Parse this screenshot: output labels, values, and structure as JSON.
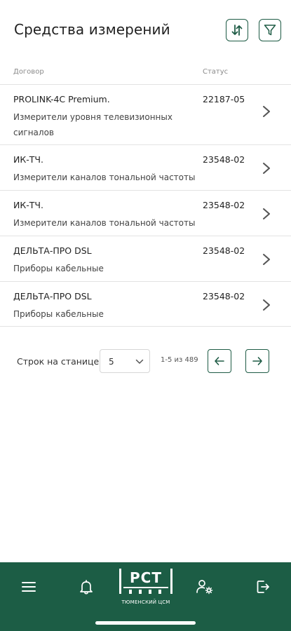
{
  "header": {
    "title": "Средства измерений",
    "sort_icon": "sort-arrows-icon",
    "filter_icon": "filter-icon"
  },
  "table": {
    "columns": {
      "contract": "Договор",
      "status": "Статус"
    },
    "rows": [
      {
        "name": "PROLINK-4C Premium.",
        "description": "Измерители уровня телевизионных сигналов",
        "status": "22187-05"
      },
      {
        "name": "ИК-ТЧ.",
        "description": "Измерители каналов тональной частоты",
        "status": "23548-02"
      },
      {
        "name": "ИК-ТЧ.",
        "description": "Измерители каналов тональной частоты",
        "status": "23548-02"
      },
      {
        "name": "ДЕЛЬТА-ПРО DSL",
        "description": "Приборы кабельные",
        "status": "23548-02"
      },
      {
        "name": "ДЕЛЬТА-ПРО DSL",
        "description": "Приборы кабельные",
        "status": "23548-02"
      }
    ]
  },
  "pagination": {
    "rows_per_page_label": "Строк на станице",
    "rows_per_page_value": "5",
    "range": "1-5 из 489"
  },
  "bottom_nav": {
    "items": [
      "menu-icon",
      "bell-icon",
      "logo",
      "user-settings-icon",
      "logout-icon"
    ],
    "logo_text": "РСТ",
    "logo_sub": "ТЮМЕНСКИЙ ЦСМ"
  },
  "colors": {
    "accent": "#1c5d45",
    "divider": "#e3e3e3"
  }
}
